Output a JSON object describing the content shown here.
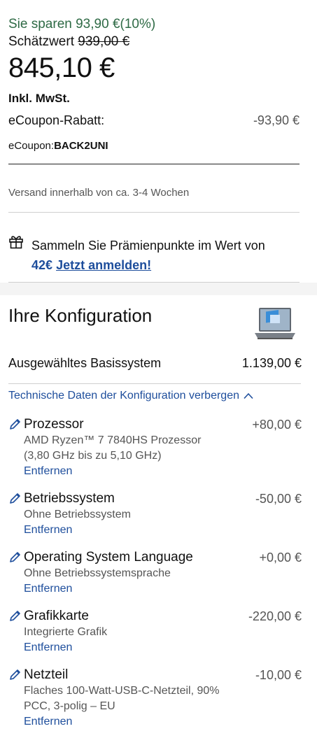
{
  "pricing": {
    "savings_text": "Sie sparen 93,90 €(10%)",
    "estimate_label": "Schätzwert",
    "estimate_value": "939,00 €",
    "price": "845,10 €",
    "vat": "Inkl. MwSt.",
    "coupon_label": "eCoupon-Rabatt:",
    "coupon_amount": "-93,90 €",
    "coupon_code_label": "eCoupon:",
    "coupon_code": "BACK2UNI"
  },
  "shipping": "Versand innerhalb von ca. 3-4 Wochen",
  "rewards": {
    "text": "Sammeln Sie Prämienpunkte im Wert von",
    "amount": "42€",
    "link": "Jetzt anmelden!"
  },
  "configuration": {
    "title": "Ihre Konfiguration",
    "base_label": "Ausgewähltes Basissystem",
    "base_price": "1.139,00 €",
    "tech_link": "Technische Daten der Konfiguration verbergen",
    "items": [
      {
        "name": "Prozessor",
        "delta": "+80,00 €",
        "desc": "AMD Ryzen™ 7 7840HS Prozessor (3,80 GHz bis zu 5,10 GHz)",
        "remove": "Entfernen"
      },
      {
        "name": "Betriebssystem",
        "delta": "-50,00 €",
        "desc": "Ohne Betriebssystem",
        "remove": "Entfernen"
      },
      {
        "name": "Operating System Language",
        "delta": "+0,00 €",
        "desc": "Ohne Betriebssystemsprache",
        "remove": "Entfernen"
      },
      {
        "name": "Grafikkarte",
        "delta": "-220,00 €",
        "desc": "Integrierte Grafik",
        "remove": "Entfernen"
      },
      {
        "name": "Netzteil",
        "delta": "-10,00 €",
        "desc": "Flaches 100-Watt-USB-C-Netzteil, 90% PCC, 3-polig – EU",
        "remove": "Entfernen"
      }
    ]
  },
  "icons": {
    "gift": "gift-icon",
    "laptop": "laptop-image",
    "chevron": "chevron-up-icon",
    "pencil": "pencil-icon"
  },
  "colors": {
    "savings": "#2e6a45",
    "link": "#1e4e9c",
    "muted": "#555555"
  }
}
